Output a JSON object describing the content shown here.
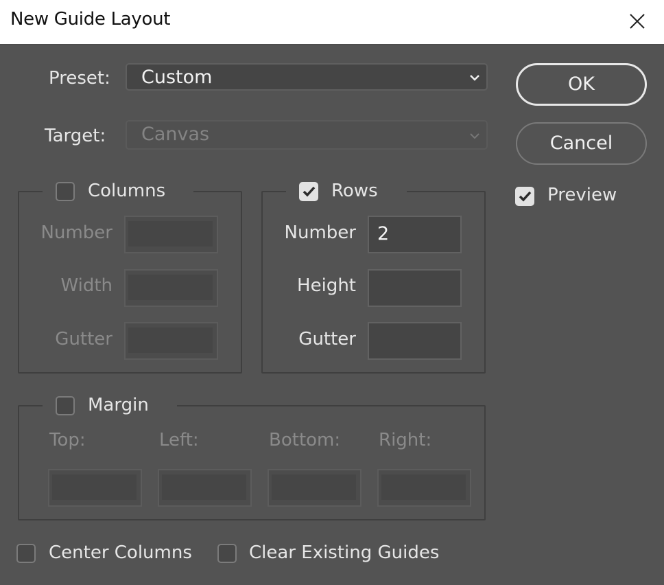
{
  "window": {
    "title": "New Guide Layout",
    "close_icon": "close-icon"
  },
  "preset": {
    "label": "Preset:",
    "value": "Custom",
    "icon": "chevron-down-icon"
  },
  "target": {
    "label": "Target:",
    "value": "Canvas",
    "enabled": false,
    "icon": "chevron-down-icon"
  },
  "buttons": {
    "ok": "OK",
    "cancel": "Cancel"
  },
  "preview": {
    "label": "Preview",
    "checked": true
  },
  "columns": {
    "label": "Columns",
    "checked": false,
    "fields": [
      {
        "label": "Number",
        "value": ""
      },
      {
        "label": "Width",
        "value": ""
      },
      {
        "label": "Gutter",
        "value": ""
      }
    ]
  },
  "rows": {
    "label": "Rows",
    "checked": true,
    "fields": [
      {
        "label": "Number",
        "value": "2"
      },
      {
        "label": "Height",
        "value": ""
      },
      {
        "label": "Gutter",
        "value": ""
      }
    ]
  },
  "margin": {
    "label": "Margin",
    "checked": false,
    "fields": [
      {
        "label": "Top:",
        "value": ""
      },
      {
        "label": "Left:",
        "value": ""
      },
      {
        "label": "Bottom:",
        "value": ""
      },
      {
        "label": "Right:",
        "value": ""
      }
    ]
  },
  "options": {
    "center_columns": {
      "label": "Center Columns",
      "checked": false
    },
    "clear_existing_guides": {
      "label": "Clear Existing Guides",
      "checked": false
    }
  },
  "colors": {
    "dialog_bg": "#535353",
    "titlebar_bg": "#ffffff",
    "field_bg": "#454545",
    "checkbox_checked": "#e2e2e2"
  }
}
